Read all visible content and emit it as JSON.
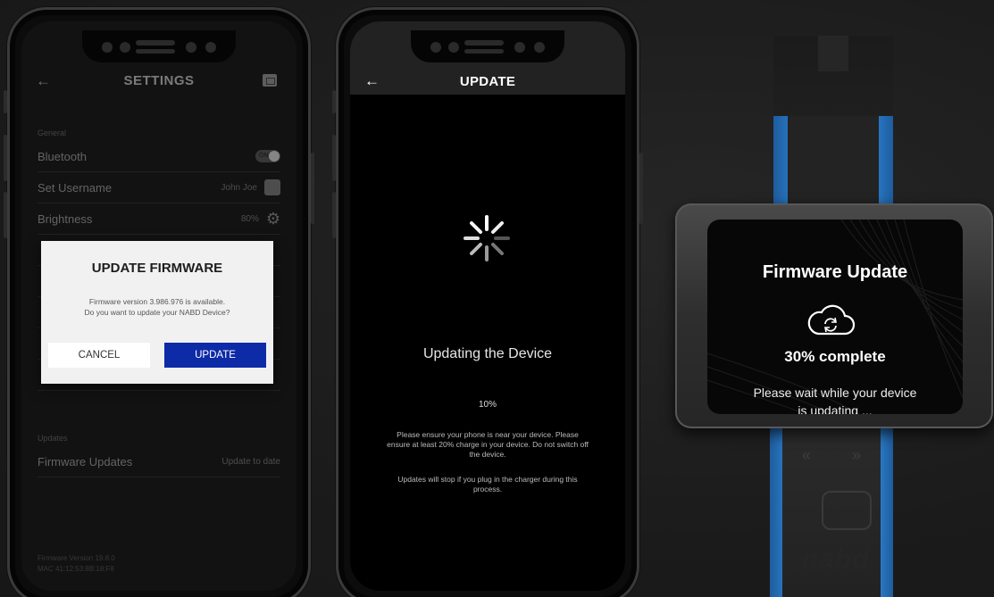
{
  "settings_phone": {
    "title": "SETTINGS",
    "back_icon": "arrow-left-icon",
    "general_label": "General",
    "rows": [
      {
        "label": "Bluetooth",
        "value": "ON"
      },
      {
        "label": "Set Username",
        "value": "John Joe"
      },
      {
        "label": "Brightness",
        "value": "80%"
      }
    ],
    "updates_label": "Updates",
    "firmware_row": {
      "label": "Firmware Updates",
      "value": "Update to date"
    },
    "footer_line1": "Firmware Version 19.8.0",
    "footer_line2": "MAC 41:12:53:8B:18:F8"
  },
  "modal": {
    "title": "UPDATE FIRMWARE",
    "message_line1": "Firmware version 3.986.976 is available.",
    "message_line2": "Do you want to update your NABD Device?",
    "cancel_label": "CANCEL",
    "update_label": "UPDATE"
  },
  "update_phone": {
    "title": "UPDATE",
    "heading": "Updating the Device",
    "percent": "10%",
    "note1": "Please ensure your phone is near your device. Please ensure at least 20% charge in your device. Do not switch off the device.",
    "note2": "Updates will stop if you plug in the charger during this process."
  },
  "watch": {
    "title": "Firmware Update",
    "percent_text": "30% complete",
    "note_line1": "Please wait while your device",
    "note_line2": "is updating ...",
    "brand": "nabd"
  }
}
